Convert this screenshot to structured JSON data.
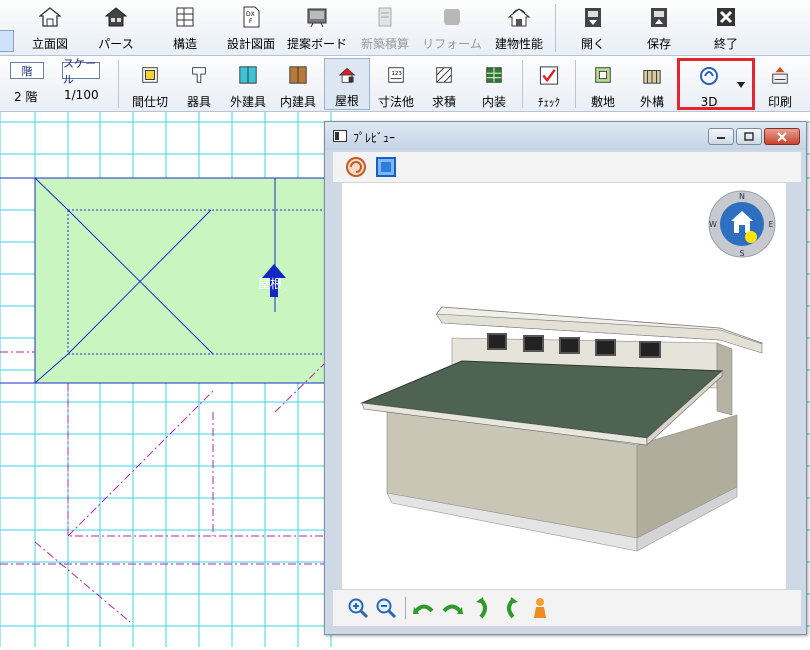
{
  "toolbar_top": {
    "items": [
      {
        "label": "立面図",
        "icon": "elevation-icon"
      },
      {
        "label": "パース",
        "icon": "house-perspective-icon"
      },
      {
        "label": "構造",
        "icon": "structure-icon"
      },
      {
        "label": "設計図面",
        "icon": "dxf-drawing-icon"
      },
      {
        "label": "提案ボード",
        "icon": "proposal-board-icon"
      },
      {
        "label": "新築積算",
        "icon": "estimate-icon"
      },
      {
        "label": "リフォーム",
        "icon": "reform-icon"
      },
      {
        "label": "建物性能",
        "icon": "building-performance-icon"
      },
      {
        "label": "開く",
        "icon": "open-icon"
      },
      {
        "label": "保存",
        "icon": "save-icon"
      },
      {
        "label": "終了",
        "icon": "exit-icon"
      }
    ]
  },
  "toolbar_second": {
    "floor_button": "階",
    "scale_button": "スケール",
    "floor_value": "2 階",
    "scale_value": "1/100",
    "items": [
      {
        "label": "間仕切",
        "icon": "partition-icon"
      },
      {
        "label": "器具",
        "icon": "fixture-icon"
      },
      {
        "label": "外建具",
        "icon": "exterior-fitting-icon"
      },
      {
        "label": "内建具",
        "icon": "interior-fitting-icon"
      },
      {
        "label": "屋根",
        "icon": "roof-icon"
      },
      {
        "label": "寸法他",
        "icon": "dimension-icon"
      },
      {
        "label": "求積",
        "icon": "area-calc-icon"
      },
      {
        "label": "内装",
        "icon": "interior-icon"
      },
      {
        "label": "ﾁｪｯｸ",
        "icon": "check-icon"
      },
      {
        "label": "敷地",
        "icon": "site-icon"
      },
      {
        "label": "外構",
        "icon": "exterior-works-icon"
      },
      {
        "label": "3D",
        "icon": "3d-icon"
      },
      {
        "label": "印刷",
        "icon": "print-icon"
      }
    ],
    "active": "屋根"
  },
  "canvas": {
    "roof_label": "屋根"
  },
  "preview_window": {
    "title": "ﾌﾟﾚﾋﾞｭｰ",
    "compass": {
      "n": "N",
      "e": "E",
      "s": "S",
      "w": "W"
    }
  },
  "colors": {
    "grid": "#3fd6dc",
    "roof_fill": "#c8f5c0",
    "roof_lines": "#1a2fc6",
    "dashed": "#b026b0",
    "highlight": "#e3262b",
    "house_roof": "#4f6352",
    "house_wall": "#bdbaa8"
  }
}
